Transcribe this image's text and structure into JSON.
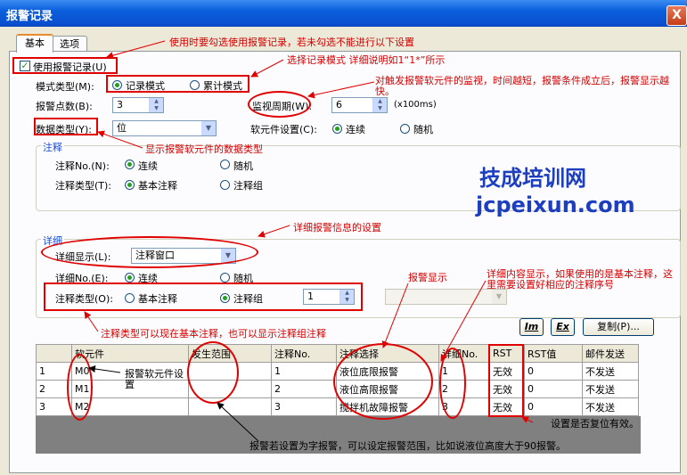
{
  "window": {
    "title": "报警记录",
    "close": "X"
  },
  "tabs": [
    "基本",
    "选项"
  ],
  "form": {
    "use_alarm_record": "使用报警记录(U)",
    "mode_label": "模式类型(M):",
    "mode_record": "记录模式",
    "mode_cumulative": "累计模式",
    "points_label": "报警点数(B):",
    "points_value": "3",
    "monitor_label": "监视周期(W):",
    "monitor_value": "6",
    "monitor_unit": "(x100ms)",
    "datatype_label": "数据类型(Y):",
    "datatype_value": "位",
    "device_setting_label": "软元件设置(C):",
    "continuous": "连续",
    "random": "随机"
  },
  "comment_group": {
    "title": "注释",
    "no_label": "注释No.(N):",
    "continuous": "连续",
    "random": "随机",
    "type_label": "注释类型(T):",
    "basic_comment": "基本注释",
    "comment_group": "注释组"
  },
  "detail_group": {
    "title": "详细",
    "display_label": "详细显示(L):",
    "display_value": "注释窗口",
    "no_label": "详细No.(E):",
    "continuous": "连续",
    "random": "随机",
    "type_label": "注释类型(O):",
    "basic_comment": "基本注释",
    "comment_group": "注释组",
    "group_value": "1"
  },
  "toolbar": {
    "im": "Im",
    "ex": "Ex",
    "copy": "复制(P)..."
  },
  "table": {
    "headers": [
      "",
      "软元件",
      "发生范围",
      "注释No.",
      "注释选择",
      "详细No.",
      "RST",
      "RST值",
      "邮件发送"
    ],
    "rows": [
      [
        "1",
        "M0",
        "",
        "1",
        "液位底限报警",
        "1",
        "无效",
        "0",
        "不发送"
      ],
      [
        "2",
        "M1",
        "",
        "2",
        "液位高限报警",
        "2",
        "无效",
        "0",
        "不发送"
      ],
      [
        "3",
        "M2",
        "",
        "3",
        "搅拌机故障报警",
        "3",
        "无效",
        "0",
        "不发送"
      ]
    ]
  },
  "watermark": {
    "cn": "技成培训网",
    "en": "jcpeixun.com"
  },
  "annotations": {
    "a1": "使用时要勾选使用报警记录，若未勾选不能进行以下设置",
    "a2": "选择记录模式  详细说明如1“1*”所示",
    "a3": "对触发报警软元件的监视，时间越短，报警条件成立后，报警显示越快。",
    "a4": "显示报警软元件的数据类型",
    "a5": "详细报警信息的设置",
    "a6": "报警显示",
    "a7": "详细内容显示，如果使用的是基本注释，这里需要设置好相应的注释序号",
    "a8": "注释类型可以现在基本注释，也可以显示注释组注释",
    "a9": "报警软元件设置",
    "a10": "设置是否复位有效。",
    "a11": "报警若设置为字报警，可以设定报警范围，比如说液位高度大于90报警。"
  },
  "colors": {
    "annotation": "#d40000",
    "title_bar": "#0a5fdc",
    "watermark": "#1d3fbf"
  }
}
